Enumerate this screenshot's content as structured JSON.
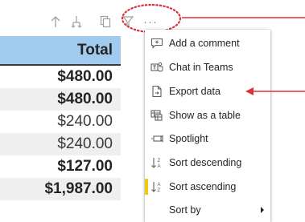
{
  "toolbar": {
    "icons": [
      "drill-up-icon",
      "drill-down-icon",
      "focus-mode-icon",
      "filter-icon",
      "more-options-icon"
    ],
    "more_label": "···"
  },
  "table": {
    "header": "Total",
    "rows": [
      {
        "value": "$480.00",
        "bold": true,
        "shaded": false
      },
      {
        "value": "$480.00",
        "bold": true,
        "shaded": true
      },
      {
        "value": "$240.00",
        "bold": false,
        "shaded": false
      },
      {
        "value": "$240.00",
        "bold": false,
        "shaded": true
      },
      {
        "value": "$127.00",
        "bold": true,
        "shaded": false
      },
      {
        "value": "$1,987.00",
        "bold": true,
        "shaded": true
      }
    ]
  },
  "menu": {
    "items": [
      {
        "label": "Add a comment",
        "icon": "comment-icon"
      },
      {
        "label": "Chat in Teams",
        "icon": "teams-icon"
      },
      {
        "label": "Export data",
        "icon": "export-icon"
      },
      {
        "label": "Show as a table",
        "icon": "table-icon"
      },
      {
        "label": "Spotlight",
        "icon": "spotlight-icon"
      },
      {
        "label": "Sort descending",
        "icon": "sort-descending-icon"
      },
      {
        "label": "Sort ascending",
        "icon": "sort-ascending-icon",
        "active": true
      },
      {
        "label": "Sort by",
        "icon": "",
        "submenu": true
      }
    ]
  },
  "colors": {
    "header_bg": "#a0cbef",
    "annotation": "#e0303a",
    "active_indicator": "#f2c811"
  }
}
